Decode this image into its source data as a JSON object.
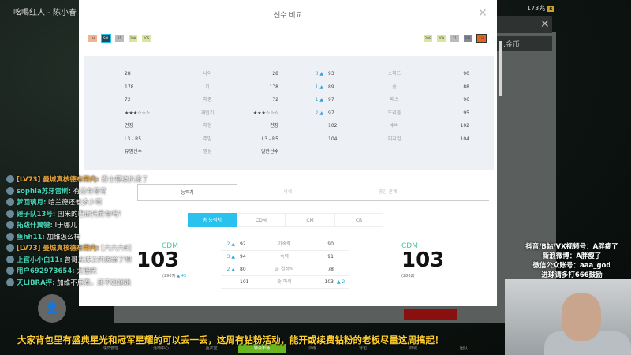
{
  "stream": {
    "title": "吆喝红人 - 陈小春",
    "banner": "大家背包里有盛典星光和冠军星耀的可以丢一丢，这周有钻粉活动，能开或续费钻粉的老板尽量这周搞起！",
    "promo": [
      "抖音/B站/VX视频号：A胖瘦了",
      "新浪微博：A胖瘦了",
      "微信公众账号：aaa_god",
      "进球请多打666鼓励"
    ]
  },
  "game": {
    "top_stat": "173兆",
    "coin": "金币",
    "nav": [
      "球员管理",
      "活动中心",
      "更衣室",
      "转会市场",
      "训练",
      "背包",
      "商城",
      "团队"
    ],
    "active_nav": 3
  },
  "modal": {
    "title": "선수 비교",
    "left_badges": [
      "LH",
      "SPL",
      "21",
      "20A",
      "20S"
    ],
    "right_badges": [
      "20S",
      "20A",
      "21",
      "SPL",
      "LH"
    ],
    "left_info": [
      {
        "a": "28",
        "label": "나이",
        "b": "28"
      },
      {
        "a": "178",
        "label": "키",
        "b": "178"
      },
      {
        "a": "72",
        "label": "체중",
        "b": "72"
      },
      {
        "a": "★★★☆☆☆",
        "label": "개인기",
        "b": "★★★☆☆☆"
      },
      {
        "a": "건장",
        "label": "체형",
        "b": "건장"
      },
      {
        "a": "L3 - R5",
        "label": "주발",
        "b": "L3 - R5"
      },
      {
        "a": "유명선수",
        "label": "명성",
        "b": "일반선수"
      }
    ],
    "right_info": [
      {
        "d": "3",
        "a": "93",
        "label": "스피드",
        "b": "90"
      },
      {
        "d": "1",
        "a": "89",
        "label": "슛",
        "b": "88"
      },
      {
        "d": "1",
        "a": "97",
        "label": "패스",
        "b": "96"
      },
      {
        "d": "2",
        "a": "97",
        "label": "드리블",
        "b": "95"
      },
      {
        "d": "",
        "a": "102",
        "label": "수비",
        "b": "102"
      },
      {
        "d": "",
        "a": "104",
        "label": "피지컬",
        "b": "104"
      }
    ],
    "tabs": [
      "능력치",
      "시세",
      "영입 관계"
    ],
    "subtabs": [
      "총 능력치",
      "CDM",
      "CM",
      "CB"
    ],
    "left_player": {
      "pos": "CDM",
      "ovr": "103",
      "total": "(2907)",
      "diff": "45"
    },
    "right_player": {
      "pos": "CDM",
      "ovr": "103",
      "total": "(2862)"
    },
    "stats": [
      {
        "d": "2",
        "a": "92",
        "label": "가속력",
        "b": "90",
        "rd": ""
      },
      {
        "d": "3",
        "a": "94",
        "label": "속력",
        "b": "91",
        "rd": ""
      },
      {
        "d": "2",
        "a": "80",
        "label": "골 결정력",
        "b": "78",
        "rd": ""
      },
      {
        "d": "",
        "a": "101",
        "label": "슛 파워",
        "b": "103",
        "rd": "2"
      }
    ]
  },
  "chat": [
    {
      "name": "[LV73] 曼城真核德布劳内:",
      "msg": "爵士都被扒没了",
      "lv": true
    },
    {
      "name": "sophia苏牙雷斯:",
      "msg": "有没有尊宵"
    },
    {
      "name": "梦回璃月:",
      "msg": "哈兰德还差多少啊"
    },
    {
      "name": "锤子队13号:",
      "msg": "国米的巴斯托尼有吗?"
    },
    {
      "name": "拓跋什翼犍:",
      "msg": "I于哪儿"
    },
    {
      "name": "鱼hh11:",
      "msg": "加维怎么样"
    },
    {
      "name": "[LV73] 曼城真核德布劳内:",
      "msg": "[六六六6]",
      "lv": true
    },
    {
      "name": "上官小小白11:",
      "msg": "曾哥五波之内该给了吧"
    },
    {
      "name": "用户692973654:",
      "msg": "尤德庆"
    },
    {
      "name": "天LIBRA抨:",
      "msg": "加维不用看，还不如她她"
    }
  ]
}
